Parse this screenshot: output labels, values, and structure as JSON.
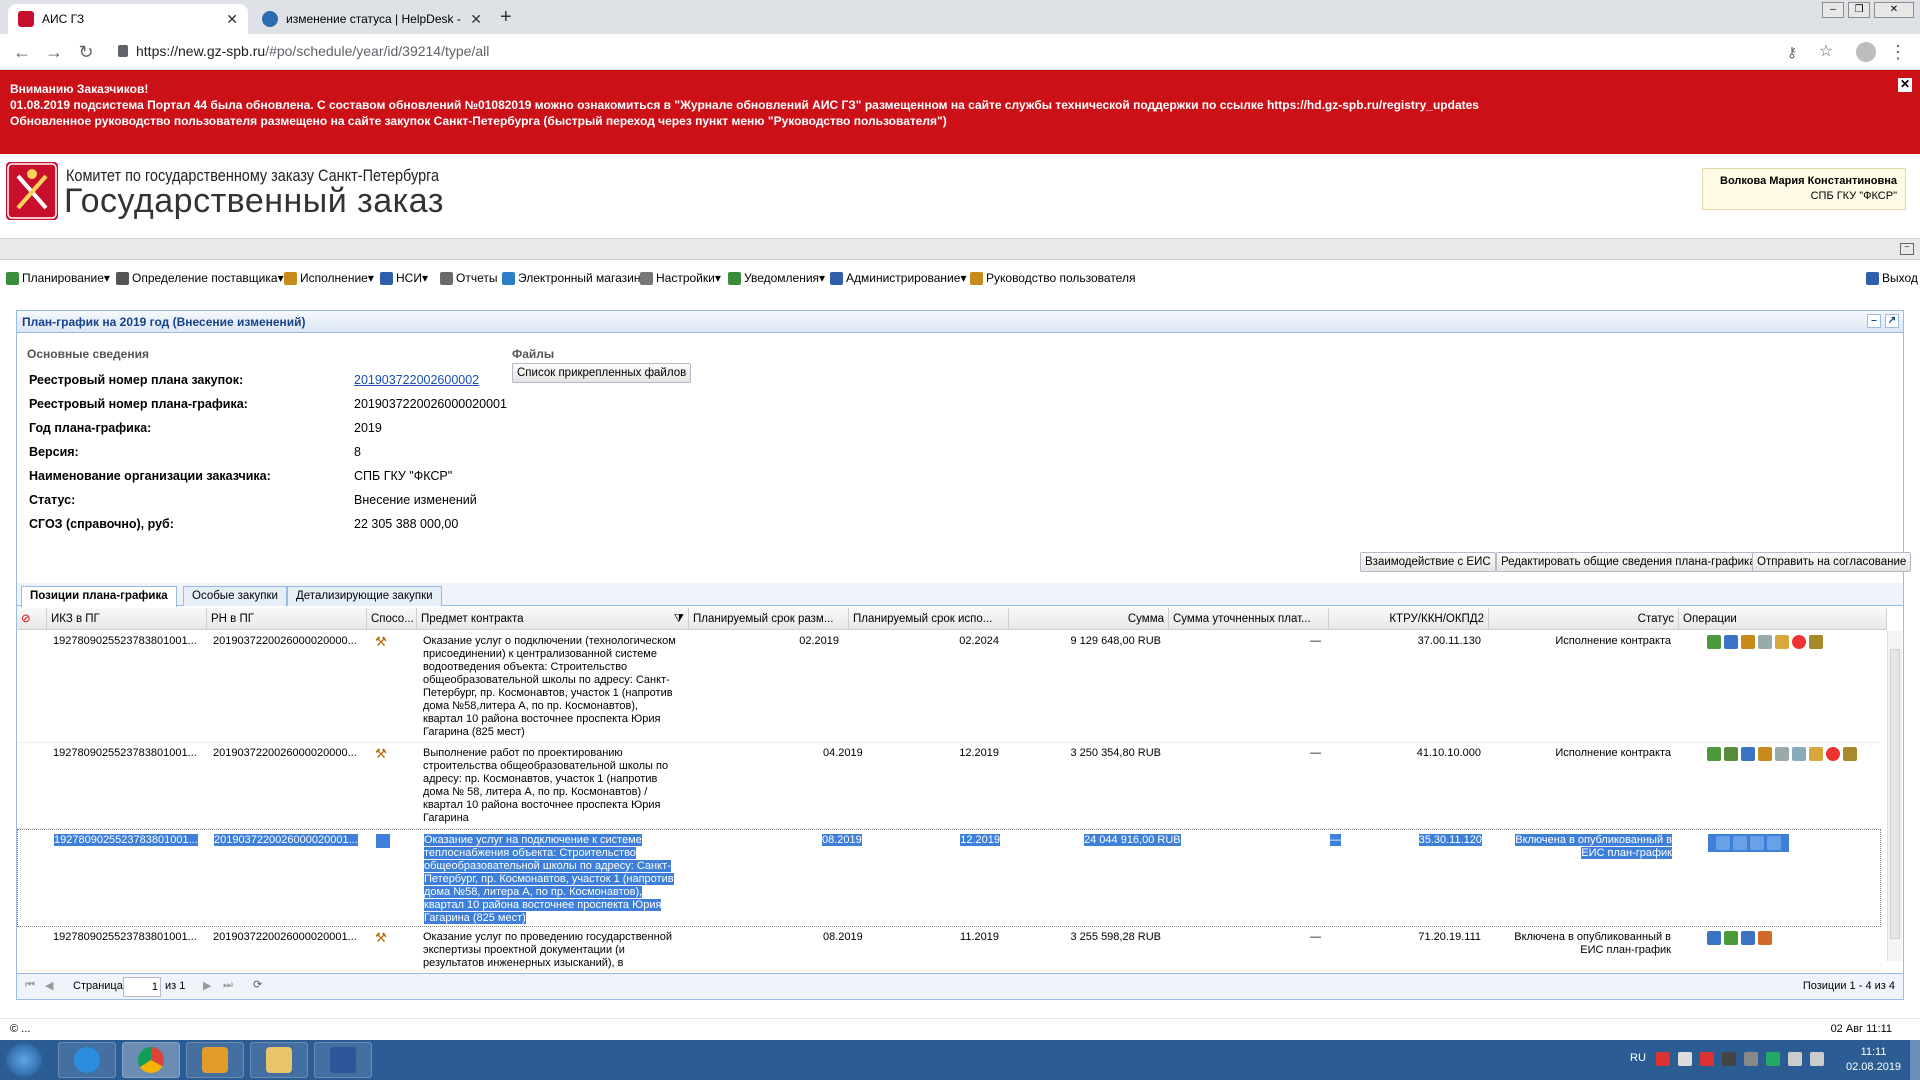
{
  "browser": {
    "tabs": [
      {
        "title": "АИС ГЗ",
        "active": true
      },
      {
        "title": "изменение статуса | HelpDesk -",
        "active": false
      }
    ],
    "new_tab": "+",
    "url_host": "https://new.gz-spb.ru",
    "url_path": "/#po/schedule/year/id/39214/type/all"
  },
  "banner": {
    "line1": "Вниманию Заказчиков!",
    "line2": "01.08.2019 подсистема Портал 44 была обновлена. С составом обновлений №01082019 можно ознакомиться в \"Журнале обновлений АИС ГЗ\" размещенном на сайте службы технической поддержки по ссылке https://hd.gz-spb.ru/registry_updates",
    "line3": "Обновленное руководство пользователя размещено на сайте закупок Санкт-Петербурга (быстрый переход через пункт меню \"Руководство пользователя\")",
    "close": "✕"
  },
  "header": {
    "org_line1": "Комитет по государственному заказу Санкт-Петербурга",
    "org_line2": "Государственный заказ",
    "user_name": "Волкова Мария Константиновна",
    "user_org": "СПБ ГКУ \"ФКСР\""
  },
  "menu": {
    "items": [
      {
        "label": "Планирование",
        "caret": "▾",
        "color": "#3a8d3a"
      },
      {
        "label": "Определение поставщика",
        "caret": "▾",
        "color": "#555555"
      },
      {
        "label": "Исполнение",
        "caret": "▾",
        "color": "#c98a1c"
      },
      {
        "label": "НСИ",
        "caret": "▾",
        "color": "#2f5faa"
      },
      {
        "label": "Отчеты",
        "caret": "",
        "color": "#6b6b6b"
      },
      {
        "label": "Электронный магазин",
        "caret": "",
        "color": "#2b7ec9"
      },
      {
        "label": "Настройки",
        "caret": "▾",
        "color": "#777777"
      },
      {
        "label": "Уведомления",
        "caret": "▾",
        "color": "#3a8d3a"
      },
      {
        "label": "Администрирование",
        "caret": "▾",
        "color": "#2f5faa"
      },
      {
        "label": "Руководство пользователя",
        "caret": "",
        "color": "#c98a1c"
      }
    ],
    "exit": "Выход"
  },
  "panel": {
    "title": "План-график на 2019 год (Внесение изменений)",
    "section_main": "Основные сведения",
    "section_files": "Файлы",
    "files_button": "Список прикрепленных файлов",
    "fields": [
      {
        "label": "Реестровый номер плана закупок:",
        "value": "201903722002600002",
        "link": true
      },
      {
        "label": "Реестровый номер плана-графика:",
        "value": "2019037220026000020001",
        "link": false
      },
      {
        "label": "Год плана-графика:",
        "value": "2019",
        "link": false
      },
      {
        "label": "Версия:",
        "value": "8",
        "link": false
      },
      {
        "label": "Наименование организации заказчика:",
        "value": "СПБ ГКУ \"ФКСР\"",
        "link": false
      },
      {
        "label": "Статус:",
        "value": "Внесение изменений",
        "link": false
      },
      {
        "label": "СГОЗ (справочно), руб:",
        "value": "22 305 388 000,00",
        "link": false
      }
    ],
    "actions": [
      "Взаимодействие с ЕИС",
      "Редактировать общие сведения плана-графика",
      "Отправить на согласование"
    ]
  },
  "tabs": [
    "Позиции плана-графика",
    "Особые закупки",
    "Детализирующие закупки"
  ],
  "grid": {
    "columns": [
      "ИКЗ в ПГ",
      "РН в ПГ",
      "Спосо...",
      "Предмет контракта",
      "Планируемый срок разм...",
      "Планируемый срок испо...",
      "Сумма",
      "Сумма уточненных плат...",
      "КТРУ/ККН/ОКПД2",
      "Статус",
      "Операции"
    ],
    "rows": [
      {
        "ikz": "1927809025523783801001...",
        "rn": "2019037220026000020000...",
        "subject": "Оказание услуг о подключении (технологическом присоединении) к централизованной системе водоотведения объекта: Строительство общеобразовательной школы по адресу: Санкт-Петербург, пр. Космонавтов, участок 1 (напротив дома №58,литера А, по пр. Космонавтов), квартал 10 района восточнее проспекта Юрия Гагарина (825 мест)",
        "plan_place": "02.2019",
        "plan_exec": "02.2024",
        "sum": "9 129 648,00 RUB",
        "sum_refined": "—",
        "ktru": "37.00.11.130",
        "status": "Исполнение контракта",
        "selected": false
      },
      {
        "ikz": "1927809025523783801001...",
        "rn": "2019037220026000020000...",
        "subject": "Выполнение работ по проектированию строительства общеобразовательной школы по адресу: пр. Космонавтов, участок 1 (напротив дома № 58, литера А, по пр. Космонавтов) / квартал 10 района восточнее проспекта Юрия Гагарина",
        "plan_place": "04.2019",
        "plan_exec": "12.2019",
        "sum": "3 250 354,80 RUB",
        "sum_refined": "—",
        "ktru": "41.10.10.000",
        "status": "Исполнение контракта",
        "selected": false
      },
      {
        "ikz": "1927809025523783801001...",
        "rn": "2019037220026000020001...",
        "subject": "Оказание услуг на подключение к системе теплоснабжения объекта: Строительство общеобразовательной школы по адресу: Санкт-Петербург, пр. Космонавтов, участок 1 (напротив дома №58, литера А, по пр. Космонавтов), квартал 10 района восточнее проспекта Юрия Гагарина (825 мест)",
        "plan_place": "08.2019",
        "plan_exec": "12.2019",
        "sum": "24 044 916,00 RUB",
        "sum_refined": "—",
        "ktru": "35.30.11.120",
        "status": "Включена в опубликованный в ЕИС план-график",
        "selected": true
      },
      {
        "ikz": "1927809025523783801001...",
        "rn": "2019037220026000020001...",
        "subject": "Оказание услуг по проведению государственной экспертизы проектной документации (и результатов инженерных изысканий), в",
        "plan_place": "08.2019",
        "plan_exec": "11.2019",
        "sum": "3 255 598,28 RUB",
        "sum_refined": "—",
        "ktru": "71.20.19.111",
        "status": "Включена в опубликованный в ЕИС план-график",
        "selected": false
      }
    ]
  },
  "pager": {
    "page_label": "Страница",
    "page_value": "1",
    "of_label": "из 1",
    "summary": "Позиции 1 - 4 из 4"
  },
  "statusbar": {
    "left": "© ...",
    "right": "02 Авг 11:11"
  },
  "taskbar": {
    "lang": "RU",
    "time": "11:11",
    "date": "02.08.2019"
  }
}
